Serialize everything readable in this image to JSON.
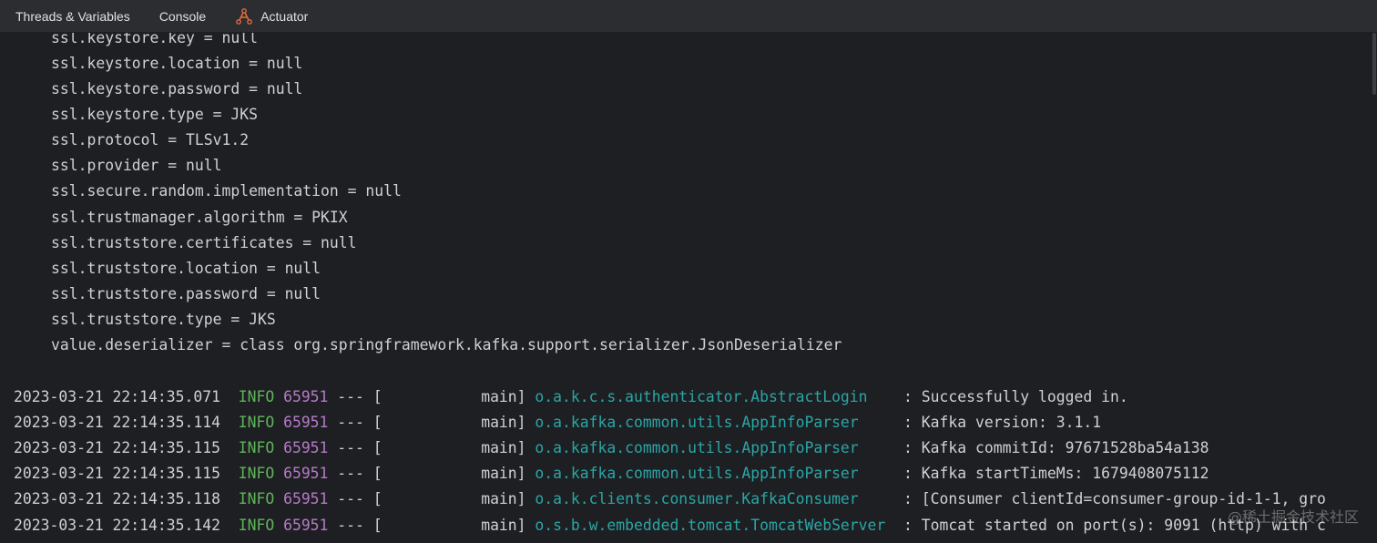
{
  "tabs": [
    {
      "label": "Threads & Variables"
    },
    {
      "label": "Console"
    },
    {
      "label": "Actuator"
    }
  ],
  "properties": [
    "ssl.keystore.key = null",
    "ssl.keystore.location = null",
    "ssl.keystore.password = null",
    "ssl.keystore.type = JKS",
    "ssl.protocol = TLSv1.2",
    "ssl.provider = null",
    "ssl.secure.random.implementation = null",
    "ssl.trustmanager.algorithm = PKIX",
    "ssl.truststore.certificates = null",
    "ssl.truststore.location = null",
    "ssl.truststore.password = null",
    "ssl.truststore.type = JKS",
    "value.deserializer = class org.springframework.kafka.support.serializer.JsonDeserializer"
  ],
  "logs": [
    {
      "date": "2023-03-21 22:14:35.071",
      "level": "INFO",
      "pid": "65951",
      "dash": "---",
      "thread": "[           main]",
      "logger": "o.a.k.c.s.authenticator.AbstractLogin   ",
      "message": " : Successfully logged in."
    },
    {
      "date": "2023-03-21 22:14:35.114",
      "level": "INFO",
      "pid": "65951",
      "dash": "---",
      "thread": "[           main]",
      "logger": "o.a.kafka.common.utils.AppInfoParser    ",
      "message": " : Kafka version: 3.1.1"
    },
    {
      "date": "2023-03-21 22:14:35.115",
      "level": "INFO",
      "pid": "65951",
      "dash": "---",
      "thread": "[           main]",
      "logger": "o.a.kafka.common.utils.AppInfoParser    ",
      "message": " : Kafka commitId: 97671528ba54a138"
    },
    {
      "date": "2023-03-21 22:14:35.115",
      "level": "INFO",
      "pid": "65951",
      "dash": "---",
      "thread": "[           main]",
      "logger": "o.a.kafka.common.utils.AppInfoParser    ",
      "message": " : Kafka startTimeMs: 1679408075112"
    },
    {
      "date": "2023-03-21 22:14:35.118",
      "level": "INFO",
      "pid": "65951",
      "dash": "---",
      "thread": "[           main]",
      "logger": "o.a.k.clients.consumer.KafkaConsumer    ",
      "message": " : [Consumer clientId=consumer-group-id-1-1, gro"
    },
    {
      "date": "2023-03-21 22:14:35.142",
      "level": "INFO",
      "pid": "65951",
      "dash": "---",
      "thread": "[           main]",
      "logger": "o.s.b.w.embedded.tomcat.TomcatWebServer ",
      "message": " : Tomcat started on port(s): 9091 (http) with c"
    }
  ],
  "watermark": "@稀土掘金技术社区",
  "colors": {
    "background": "#1e1f22",
    "tabbar": "#2b2d30",
    "info": "#5fb45a",
    "pid": "#b67ac8",
    "logger": "#2aa6a6",
    "text": "#cfd1d4"
  },
  "icons": {
    "actuator": "actuator-icon"
  }
}
